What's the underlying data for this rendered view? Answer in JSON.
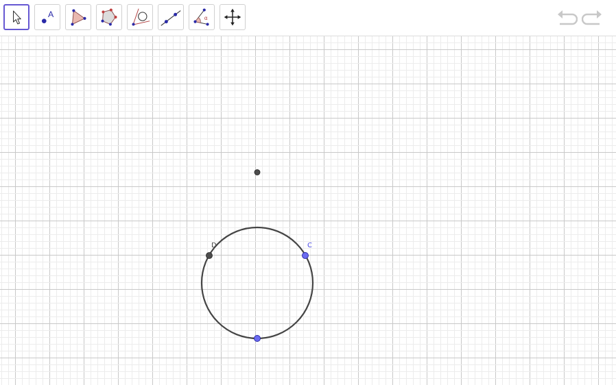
{
  "toolbar": {
    "tools": [
      {
        "name": "move-tool",
        "icon": "arrow-pointer-icon",
        "active": true
      },
      {
        "name": "point-tool",
        "icon": "point-a-icon",
        "label": "A"
      },
      {
        "name": "polygon-tool",
        "icon": "triangle-icon"
      },
      {
        "name": "regular-polygon-tool",
        "icon": "pentagon-icon"
      },
      {
        "name": "tangents-tool",
        "icon": "circle-tangent-icon"
      },
      {
        "name": "line-tool",
        "icon": "line-through-points-icon"
      },
      {
        "name": "angle-tool",
        "icon": "angle-icon",
        "label": "α"
      },
      {
        "name": "move-graphics-view-tool",
        "icon": "move-arrows-icon"
      }
    ],
    "undo_icon": "undo-icon",
    "redo_icon": "redo-icon"
  },
  "canvas": {
    "points": {
      "C": {
        "label": "C",
        "color": "#4a4ae8"
      },
      "D": {
        "label": "D",
        "color": "#444444"
      }
    },
    "colors": {
      "accent": "#6557d2",
      "free_point": "#6b6bf0",
      "dependent_point": "#4d4d4d",
      "circle": "#444444",
      "grid_major": "#c8c8c8",
      "grid_minor": "#ececec"
    }
  }
}
